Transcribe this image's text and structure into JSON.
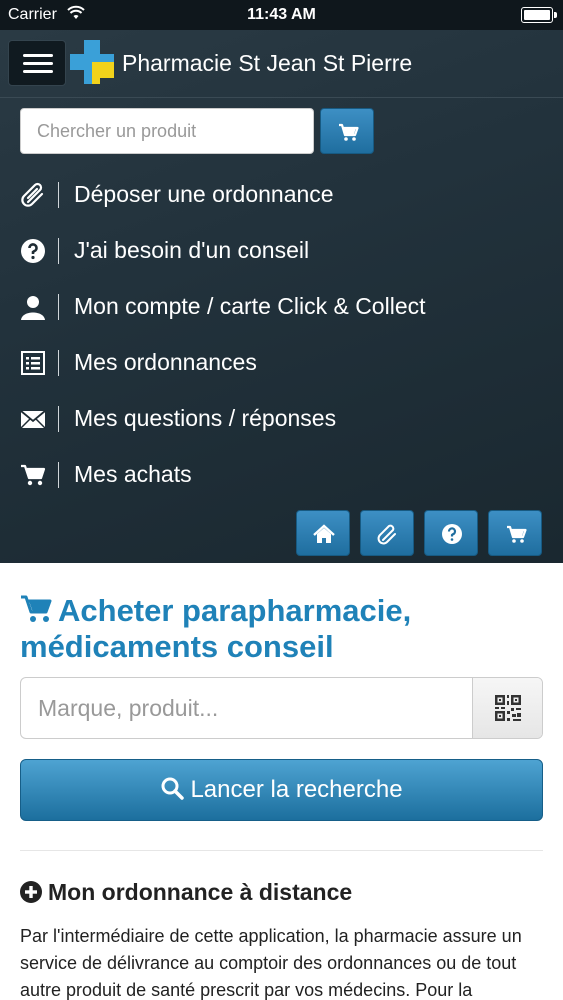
{
  "status_bar": {
    "carrier": "Carrier",
    "time": "11:43 AM"
  },
  "header": {
    "app_title": "Pharmacie St Jean St Pierre"
  },
  "menu_search": {
    "placeholder": "Chercher un produit"
  },
  "nav": {
    "items": [
      {
        "label": "Déposer une ordonnance",
        "icon": "paperclip-icon"
      },
      {
        "label": "J'ai besoin d'un conseil",
        "icon": "question-circle-icon"
      },
      {
        "label": "Mon compte / carte Click & Collect",
        "icon": "user-icon"
      },
      {
        "label": "Mes ordonnances",
        "icon": "list-icon"
      },
      {
        "label": "Mes questions / réponses",
        "icon": "envelope-icon"
      },
      {
        "label": "Mes achats",
        "icon": "cart-icon"
      }
    ]
  },
  "quick_bar": [
    "home-icon",
    "paperclip-icon",
    "question-circle-icon",
    "cart-icon"
  ],
  "main": {
    "section_title": "Acheter parapharmacie, médicaments conseil",
    "product_search_placeholder": "Marque, produit...",
    "search_button_label": "Lancer la recherche",
    "subsection_title": "Mon ordonnance à distance",
    "paragraph": "Par l'intermédiaire de cette application, la pharmacie assure un service de délivrance au comptoir des ordonnances ou de tout autre produit de santé prescrit par vos médecins. Pour la"
  },
  "colors": {
    "accent": "#1f82b8",
    "menu_bg": "#22323c",
    "button_blue": "#2a7fb4",
    "logo_blue": "#3aa0d8",
    "logo_yellow": "#f2d21b"
  }
}
